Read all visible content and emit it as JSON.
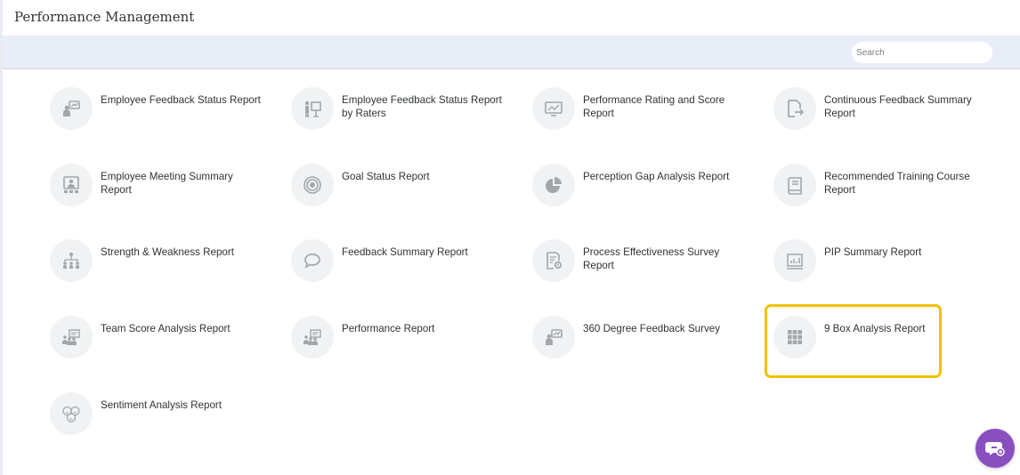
{
  "page": {
    "title": "Performance Management"
  },
  "search": {
    "placeholder": "Search",
    "value": ""
  },
  "reports": [
    {
      "label": "Employee Feedback Status Report",
      "icon": "presenter-board-icon"
    },
    {
      "label": "Employee Feedback Status Report by Raters",
      "icon": "presentation-stand-icon"
    },
    {
      "label": "Performance Rating and Score Report",
      "icon": "line-chart-monitor-icon"
    },
    {
      "label": "Continuous Feedback Summary Report",
      "icon": "document-export-icon"
    },
    {
      "label": "Employee Meeting Summary Report",
      "icon": "video-meeting-icon"
    },
    {
      "label": "Goal Status Report",
      "icon": "target-icon"
    },
    {
      "label": "Perception Gap Analysis Report",
      "icon": "pie-chart-icon"
    },
    {
      "label": "Recommended Training Course Report",
      "icon": "book-icon"
    },
    {
      "label": "Strength & Weakness Report",
      "icon": "org-chart-icon"
    },
    {
      "label": "Feedback Summary Report",
      "icon": "speech-bubble-icon"
    },
    {
      "label": "Process Effectiveness Survey Report",
      "icon": "document-gear-icon"
    },
    {
      "label": "PIP Summary Report",
      "icon": "board-chart-icon"
    },
    {
      "label": "Team Score Analysis Report",
      "icon": "team-board-icon"
    },
    {
      "label": "Performance Report",
      "icon": "team-board-icon"
    },
    {
      "label": "360 Degree Feedback Survey",
      "icon": "presenter-board-icon"
    },
    {
      "label": "9 Box Analysis Report",
      "icon": "nine-box-grid-icon",
      "highlighted": true
    },
    {
      "label": "Sentiment Analysis Report",
      "icon": "emoji-faces-icon"
    }
  ],
  "colors": {
    "toolbar_bg": "#e8edf7",
    "icon_circle": "#f1f2f3",
    "icon_stroke": "#a3a6aa",
    "highlight_border": "#f2c200",
    "chat_fab": "#8a4fbf"
  },
  "chat": {
    "icon": "chat-bubble-icon"
  }
}
